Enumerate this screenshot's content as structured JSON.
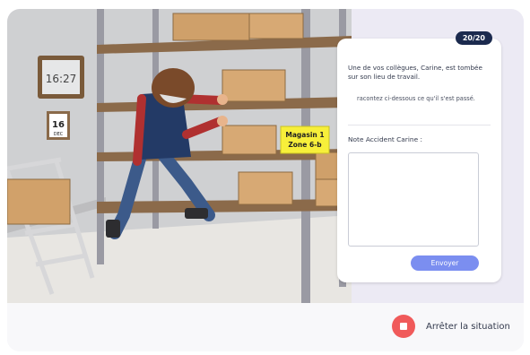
{
  "scene": {
    "clock_time": "16:27",
    "calendar_day": "16",
    "calendar_month": "DEC",
    "sign_line1": "Magasin 1",
    "sign_line2": "Zone 6-b"
  },
  "panel": {
    "counter": "20/20",
    "message": "Une de vos collègues, Carine, est tombée sur son lieu de travail.",
    "instruction": "racontez ci-dessous ce qu'il s'est passé.",
    "note_label": "Note Accident Carine :",
    "note_value": "",
    "send_label": "Envoyer"
  },
  "footer": {
    "stop_label": "Arrêter la situation"
  },
  "colors": {
    "badge": "#1b2a4e",
    "send_button": "#7b8ef0",
    "stop_button": "#f05a5a",
    "sign": "#f7ef3a"
  }
}
